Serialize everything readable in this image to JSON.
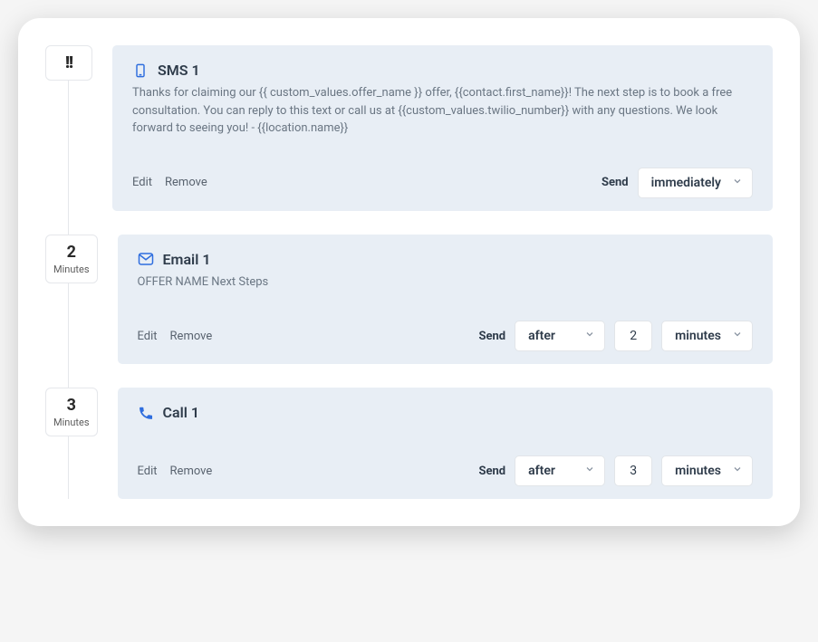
{
  "steps": [
    {
      "time_display": "pause",
      "time_value": "",
      "time_unit": "",
      "type": "sms",
      "title": "SMS 1",
      "body": "Thanks for claiming our {{ custom_values.offer_name }} offer, {{contact.first_name}}! The next step is to book a free consultation. You can reply to this text or call us at {{custom_values.twilio_number}} with any questions. We look forward to seeing you! - {{location.name}}",
      "edit_label": "Edit",
      "remove_label": "Remove",
      "send_label": "Send",
      "send_mode": "immediately",
      "send_value": "",
      "send_unit": ""
    },
    {
      "time_display": "value",
      "time_value": "2",
      "time_unit": "Minutes",
      "type": "email",
      "title": "Email 1",
      "body": "OFFER NAME Next Steps",
      "edit_label": "Edit",
      "remove_label": "Remove",
      "send_label": "Send",
      "send_mode": "after",
      "send_value": "2",
      "send_unit": "minutes"
    },
    {
      "time_display": "value",
      "time_value": "3",
      "time_unit": "Minutes",
      "type": "call",
      "title": "Call 1",
      "body": "",
      "edit_label": "Edit",
      "remove_label": "Remove",
      "send_label": "Send",
      "send_mode": "after",
      "send_value": "3",
      "send_unit": "minutes"
    }
  ]
}
